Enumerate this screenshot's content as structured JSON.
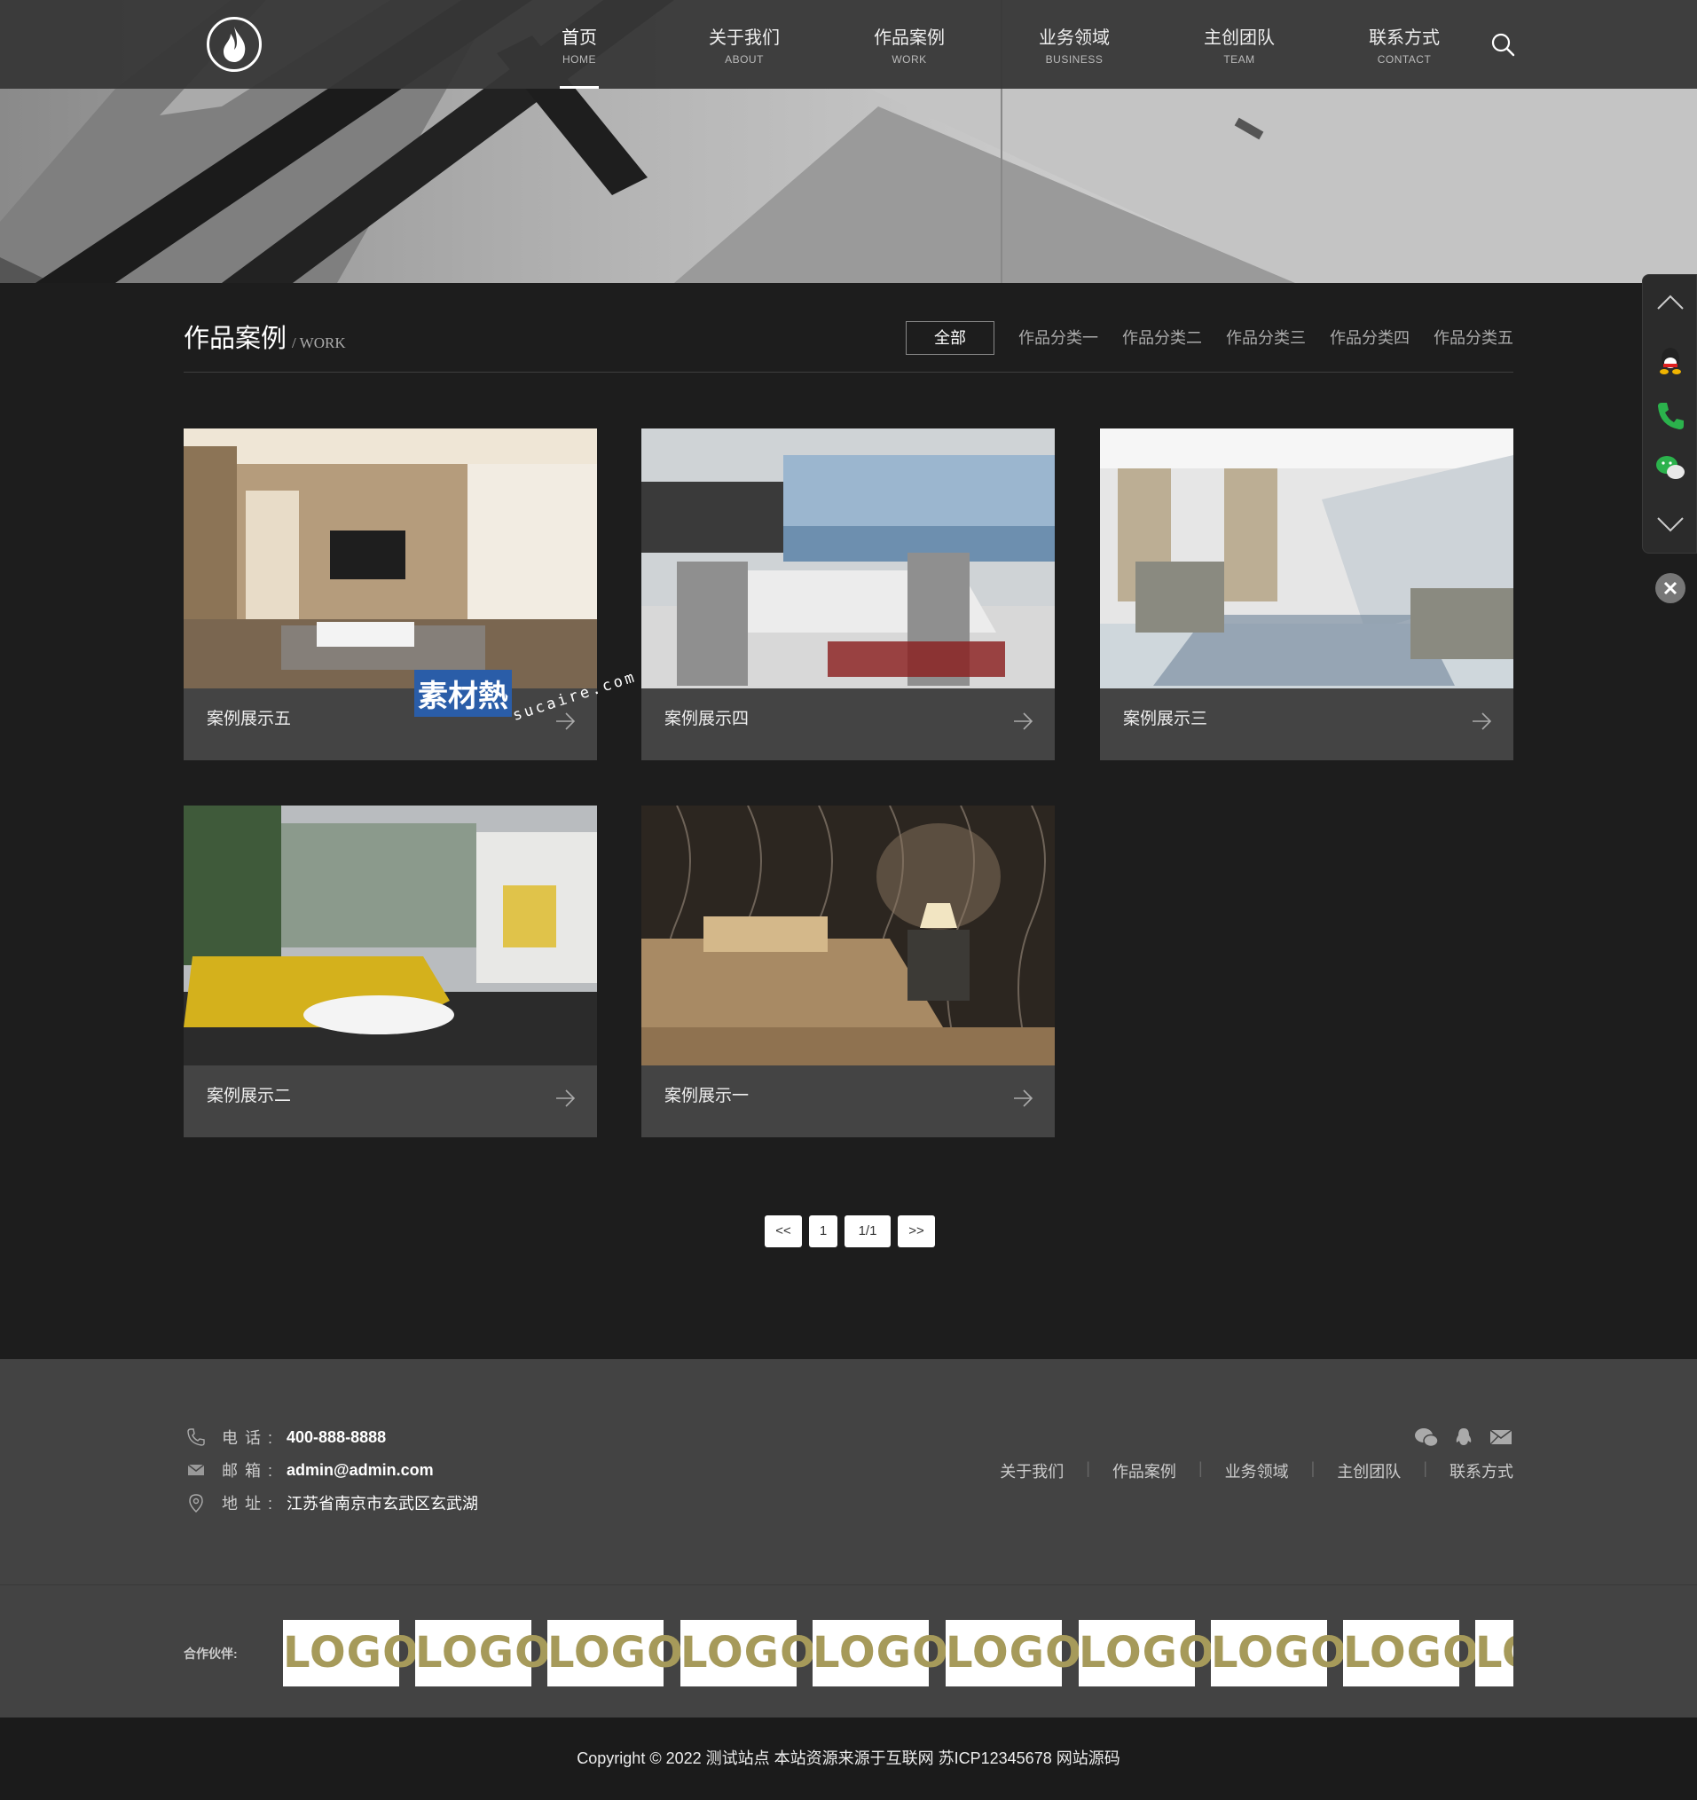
{
  "nav": {
    "items": [
      {
        "cn": "首页",
        "en": "HOME"
      },
      {
        "cn": "关于我们",
        "en": "ABOUT"
      },
      {
        "cn": "作品案例",
        "en": "WORK"
      },
      {
        "cn": "业务领域",
        "en": "BUSINESS"
      },
      {
        "cn": "主创团队",
        "en": "TEAM"
      },
      {
        "cn": "联系方式",
        "en": "CONTACT"
      }
    ],
    "active_index": 0
  },
  "section": {
    "title": "作品案例",
    "subtitle": "/ WORK",
    "filters": [
      "全部",
      "作品分类一",
      "作品分类二",
      "作品分类三",
      "作品分类四",
      "作品分类五"
    ]
  },
  "cases": [
    {
      "title": "案例展示五"
    },
    {
      "title": "案例展示四"
    },
    {
      "title": "案例展示三"
    },
    {
      "title": "案例展示二"
    },
    {
      "title": "案例展示一"
    }
  ],
  "watermark": {
    "text": "素材熱",
    "url": "sucaire.com"
  },
  "pager": {
    "prev": "<<",
    "page": "1",
    "total": "1/1",
    "next": ">>"
  },
  "contact": {
    "phone_label": "电话:",
    "phone": "400-888-8888",
    "email_label": "邮箱:",
    "email": "admin@admin.com",
    "address_label": "地址:",
    "address": "江苏省南京市玄武区玄武湖"
  },
  "footer_nav": [
    "关于我们",
    "作品案例",
    "业务领域",
    "主创团队",
    "联系方式"
  ],
  "partners": {
    "title": "合作伙伴:",
    "logos": [
      "LOGO",
      "LOGO",
      "LOGO",
      "LOGO",
      "LOGO",
      "LOGO",
      "LOGO",
      "LOGO",
      "LOGO",
      "LOGO"
    ]
  },
  "copyright": "Copyright © 2022 测试站点 本站资源来源于互联网 苏ICP12345678 网站源码",
  "colors": {
    "background": "#1d1d1d",
    "footer": "#434343",
    "card": "#444444",
    "logo_text": "#a69a5a"
  }
}
